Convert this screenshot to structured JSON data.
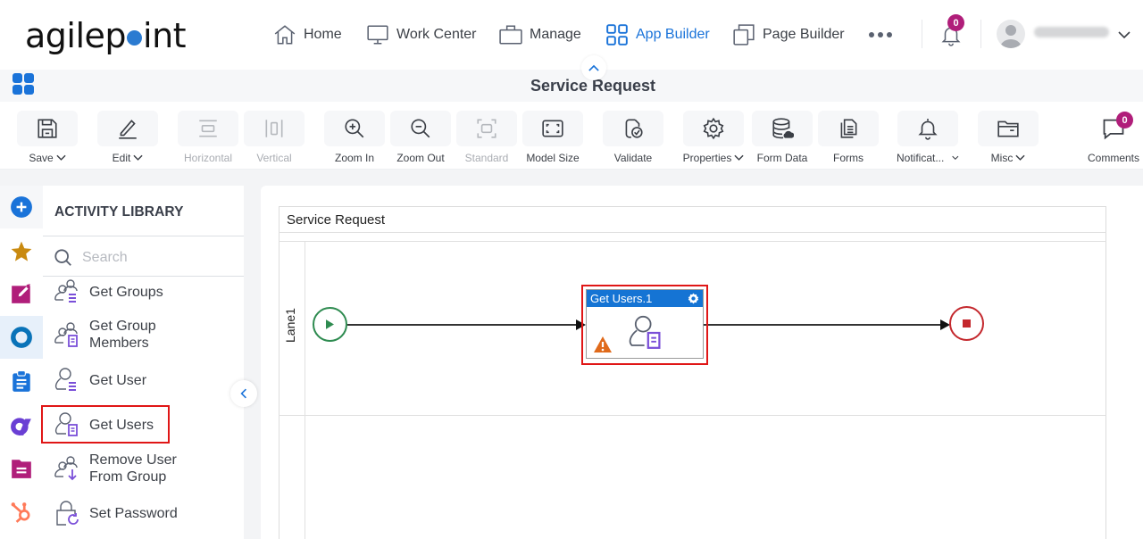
{
  "header": {
    "logo_text_pre": "agilep",
    "logo_text_post": "int",
    "nav": [
      {
        "label": "Home",
        "icon": "home-icon",
        "active": false
      },
      {
        "label": "Work Center",
        "icon": "monitor-icon",
        "active": false
      },
      {
        "label": "Manage",
        "icon": "briefcase-icon",
        "active": false
      },
      {
        "label": "App Builder",
        "icon": "grid-icon",
        "active": true
      },
      {
        "label": "Page Builder",
        "icon": "copy-pages-icon",
        "active": false
      }
    ],
    "more_icon": "more-horizontal-icon",
    "notifications_count": "0",
    "user_icon": "user-avatar-icon",
    "accent_color": "#1a73d9",
    "badge_color": "#b01e7a"
  },
  "title_bar": {
    "title": "Service Request"
  },
  "toolbar": {
    "items": [
      {
        "label": "Save",
        "icon": "save-icon",
        "dropdown": true,
        "disabled": false
      },
      {
        "label": "Edit",
        "icon": "pencil-icon",
        "dropdown": true,
        "disabled": false
      },
      {
        "label": "Horizontal",
        "icon": "horizontal-layout-icon",
        "dropdown": false,
        "disabled": true
      },
      {
        "label": "Vertical",
        "icon": "vertical-layout-icon",
        "dropdown": false,
        "disabled": true
      },
      {
        "label": "Zoom In",
        "icon": "zoom-in-icon",
        "dropdown": false,
        "disabled": false
      },
      {
        "label": "Zoom Out",
        "icon": "zoom-out-icon",
        "dropdown": false,
        "disabled": false
      },
      {
        "label": "Standard",
        "icon": "standard-size-icon",
        "dropdown": false,
        "disabled": true
      },
      {
        "label": "Model Size",
        "icon": "fit-screen-icon",
        "dropdown": false,
        "disabled": false
      },
      {
        "label": "Validate",
        "icon": "validate-icon",
        "dropdown": false,
        "disabled": false
      },
      {
        "label": "Properties",
        "icon": "gear-icon",
        "dropdown": true,
        "disabled": false
      },
      {
        "label": "Form Data",
        "icon": "database-icon",
        "dropdown": false,
        "disabled": false
      },
      {
        "label": "Forms",
        "icon": "forms-icon",
        "dropdown": false,
        "disabled": false
      },
      {
        "label": "Notificat...",
        "icon": "bell-icon",
        "dropdown": true,
        "disabled": false
      },
      {
        "label": "Misc",
        "icon": "folder-icon",
        "dropdown": true,
        "disabled": false
      },
      {
        "label": "Comments",
        "icon": "comment-icon",
        "dropdown": false,
        "disabled": false,
        "badge": "0"
      }
    ]
  },
  "left_rail": {
    "items": [
      {
        "icon": "add-circle-icon",
        "color": "#1a73d9"
      },
      {
        "icon": "star-icon",
        "color": "#c98a10"
      },
      {
        "icon": "edit-square-icon",
        "color": "#b01e7a"
      },
      {
        "icon": "circle-ring-icon",
        "color": "#0a73b8",
        "active": true
      },
      {
        "icon": "clipboard-icon",
        "color": "#1a73d9"
      },
      {
        "icon": "ai-logo-icon",
        "color": "#6a3fd4"
      },
      {
        "icon": "folder-doc-icon",
        "color": "#b01e7a"
      },
      {
        "icon": "hubspot-icon",
        "color": "#ff7a59"
      }
    ]
  },
  "activity_library": {
    "title": "ACTIVITY LIBRARY",
    "search_placeholder": "Search",
    "search_value": "",
    "items": [
      {
        "label_line1": "Get Groups",
        "label_line2": "",
        "icon": "get-groups-icon"
      },
      {
        "label_line1": "Get Group",
        "label_line2": "Members",
        "icon": "get-group-members-icon"
      },
      {
        "label_line1": "Get User",
        "label_line2": "",
        "icon": "get-user-icon"
      },
      {
        "label_line1": "Get Users",
        "label_line2": "",
        "icon": "get-users-icon",
        "highlighted": true
      },
      {
        "label_line1": "Remove User",
        "label_line2": "From Group",
        "icon": "remove-user-icon"
      },
      {
        "label_line1": "Set Password",
        "label_line2": "",
        "icon": "set-password-icon"
      }
    ]
  },
  "canvas": {
    "pool_title": "Service Request",
    "lane_label": "Lane1",
    "activity": {
      "title": "Get Users.1",
      "warning": true,
      "header_color": "#1574d4"
    },
    "start_event_color": "#2e8b50",
    "end_event_color": "#c4282d",
    "highlight_color": "#e01616"
  }
}
